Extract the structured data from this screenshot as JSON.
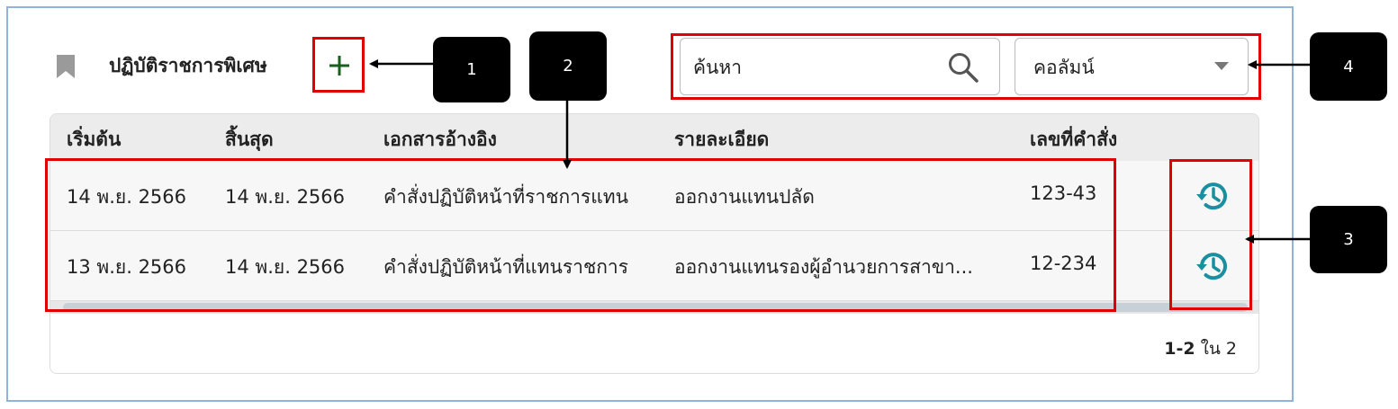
{
  "section": {
    "title": "ปฏิบัติราชการพิเศษ",
    "icons": {
      "bookmark": "bookmark-icon",
      "add": "plus-icon"
    }
  },
  "search": {
    "placeholder": "ค้นหา",
    "value": "",
    "icon": "search-icon"
  },
  "column_select": {
    "label": "คอลัมน์",
    "icon": "chevron-down-icon"
  },
  "table": {
    "columns": [
      "เริ่มต้น",
      "สิ้นสุด",
      "เอกสารอ้างอิง",
      "รายละเอียด",
      "เลขที่คำสั่ง"
    ],
    "rows": [
      {
        "start": "14 พ.ย. 2566",
        "end": "14 พ.ย. 2566",
        "reference": "คำสั่งปฏิบัติหน้าที่ราชการแทน",
        "detail": "ออกงานแทนปลัด",
        "order_no": "123-43",
        "action_icon": "history-icon"
      },
      {
        "start": "13 พ.ย. 2566",
        "end": "14 พ.ย. 2566",
        "reference": "คำสั่งปฏิบัติหน้าที่แทนราชการ",
        "detail": "ออกงานแทนรองผู้อำนวยการสาขา...",
        "order_no": "12-234",
        "action_icon": "history-icon"
      }
    ]
  },
  "pagination": {
    "range": "1-2",
    "suffix": "ใน 2"
  },
  "annotations": [
    "1",
    "2",
    "3",
    "4"
  ],
  "colors": {
    "accent_green": "#1b5e20",
    "history_teal": "#1a8fa0",
    "highlight_red": "#e00000",
    "frame_blue": "#8fb3d9"
  }
}
